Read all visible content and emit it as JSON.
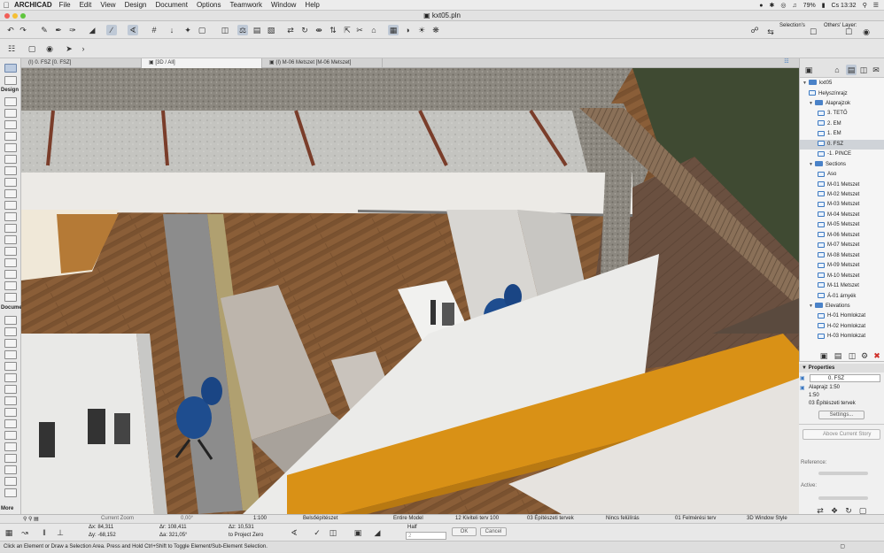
{
  "menubar": {
    "app": "ARCHICAD",
    "items": [
      "File",
      "Edit",
      "View",
      "Design",
      "Document",
      "Options",
      "Teamwork",
      "Window",
      "Help"
    ],
    "battery": "79%",
    "clock": "Cs 13:32"
  },
  "window": {
    "title": "kxt05.pln"
  },
  "toolbar": {
    "selections_label": "Selection's",
    "others_layer_label": "Others' Layer:"
  },
  "tabs": [
    {
      "label": "(I) 0. FSZ [0. FSZ]",
      "active": false
    },
    {
      "label": "[3D / All]",
      "active": true
    },
    {
      "label": "(I) M-06 Metszet [M-06 Metszet]",
      "active": false
    }
  ],
  "toolbox": {
    "design_label": "Design",
    "document_label": "Docume",
    "more_label": "More"
  },
  "navigator": {
    "root": "kxt05",
    "items": [
      {
        "label": "Helyszínrajz",
        "level": 1,
        "kind": "item"
      },
      {
        "label": "Alaprajzok",
        "level": 1,
        "kind": "folder"
      },
      {
        "label": "3. TETŐ",
        "level": 2,
        "kind": "item"
      },
      {
        "label": "2. EM",
        "level": 2,
        "kind": "item"
      },
      {
        "label": "1. EM",
        "level": 2,
        "kind": "item"
      },
      {
        "label": "0. FSZ",
        "level": 2,
        "kind": "item",
        "selected": true
      },
      {
        "label": "-1. PINCE",
        "level": 2,
        "kind": "item"
      },
      {
        "label": "Sections",
        "level": 1,
        "kind": "folder"
      },
      {
        "label": "Aso",
        "level": 2,
        "kind": "item"
      },
      {
        "label": "M-01 Metszet",
        "level": 2,
        "kind": "item"
      },
      {
        "label": "M-02 Metszet",
        "level": 2,
        "kind": "item"
      },
      {
        "label": "M-03 Metszet",
        "level": 2,
        "kind": "item"
      },
      {
        "label": "M-04 Metszet",
        "level": 2,
        "kind": "item"
      },
      {
        "label": "M-05 Metszet",
        "level": 2,
        "kind": "item"
      },
      {
        "label": "M-06 Metszet",
        "level": 2,
        "kind": "item"
      },
      {
        "label": "M-07 Metszet",
        "level": 2,
        "kind": "item"
      },
      {
        "label": "M-08 Metszet",
        "level": 2,
        "kind": "item"
      },
      {
        "label": "M-09 Metszet",
        "level": 2,
        "kind": "item"
      },
      {
        "label": "M-10 Metszet",
        "level": 2,
        "kind": "item"
      },
      {
        "label": "M-11 Metszet",
        "level": 2,
        "kind": "item"
      },
      {
        "label": "Á-01 árnyék",
        "level": 2,
        "kind": "item"
      },
      {
        "label": "Elevations",
        "level": 1,
        "kind": "folder"
      },
      {
        "label": "H-01 Homlokzat",
        "level": 2,
        "kind": "item"
      },
      {
        "label": "H-02 Homlokzat",
        "level": 2,
        "kind": "item"
      },
      {
        "label": "H-03 Homlokzat",
        "level": 2,
        "kind": "item"
      }
    ]
  },
  "properties": {
    "header": "Properties",
    "story": "0. FSZ",
    "view_type": "Alaprajz 1:50",
    "scale": "1:50",
    "layer_combo": "03 Építészeti tervek",
    "settings_button": "Settings...",
    "above_story": "Above Current Story",
    "reference_label": "Reference:",
    "active_label": "Active:"
  },
  "statusbar": {
    "zoom": "Current Zoom",
    "angle": "0,00°",
    "scale": "1:100",
    "layer_combination": "Belsőépítészet",
    "model_view": "Entire Model",
    "pen_set": "12 Kiviteli terv 100",
    "dimension": "03 Építészeti tervek",
    "override": "Nincs felülírás",
    "renovation": "01 Felmérési terv",
    "style": "3D Window Style"
  },
  "coords": {
    "dx": "Δx: 84,311",
    "dy": "Δy: -68,152",
    "dr": "Δr: 108,411",
    "da": "Δa: 321,05°",
    "dz": "Δz: 10,531",
    "to": "to Project Zero",
    "half_label": "Half",
    "half_value": "2",
    "ok": "OK",
    "cancel": "Cancel"
  },
  "hint": "Click an Element or Draw a Selection Area. Press and Hold Ctrl+Shift to Toggle Element/Sub-Element Selection."
}
